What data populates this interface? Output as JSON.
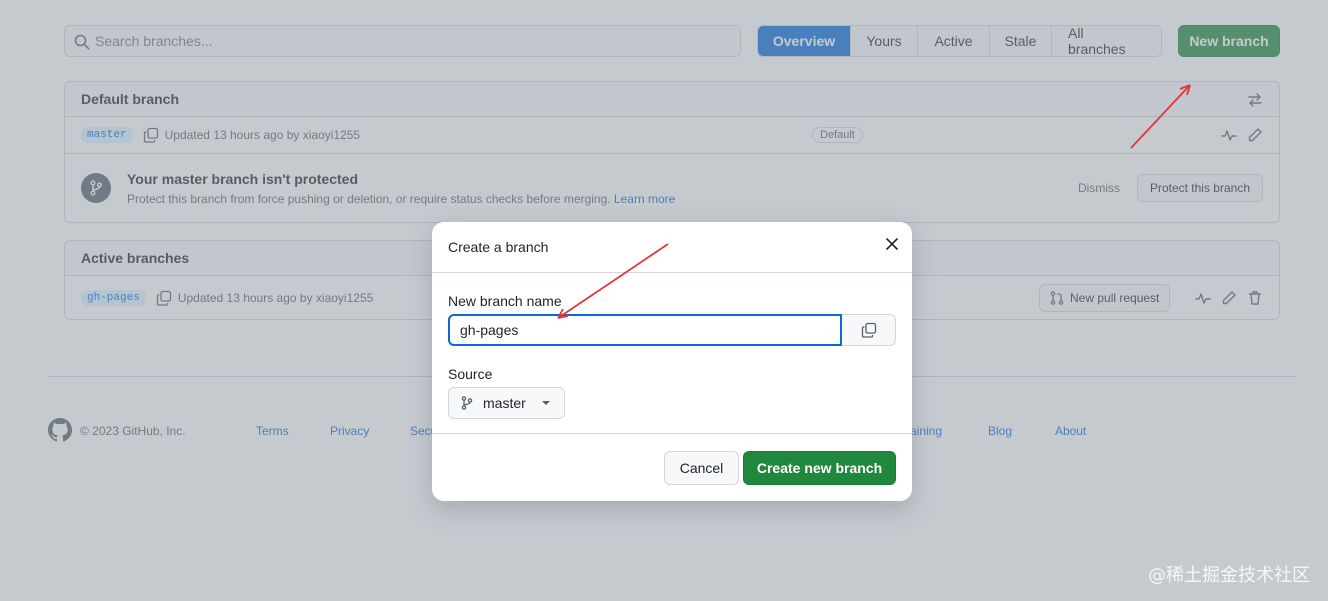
{
  "search": {
    "placeholder": "Search branches..."
  },
  "tabs": [
    {
      "label": "Overview",
      "active": true
    },
    {
      "label": "Yours",
      "active": false
    },
    {
      "label": "Active",
      "active": false
    },
    {
      "label": "Stale",
      "active": false
    },
    {
      "label": "All branches",
      "active": false
    }
  ],
  "new_branch_label": "New branch",
  "default_branch": {
    "header": "Default branch",
    "branch_name": "master",
    "updated": "Updated 13 hours ago by xiaoyi1255",
    "badge": "Default",
    "protect_title": "Your master branch isn't protected",
    "protect_desc": "Protect this branch from force pushing or deletion, or require status checks before merging.",
    "learn_more": "Learn more",
    "dismiss": "Dismiss",
    "protect_button": "Protect this branch"
  },
  "active_branches": {
    "header": "Active branches",
    "branch_name": "gh-pages",
    "updated": "Updated 13 hours ago by xiaoyi1255",
    "new_pr": "New pull request"
  },
  "footer": {
    "copyright": "© 2023 GitHub, Inc.",
    "links": [
      "Terms",
      "Privacy",
      "Secu",
      "aining",
      "Blog",
      "About"
    ]
  },
  "modal": {
    "title": "Create a branch",
    "name_label": "New branch name",
    "name_value": "gh-pages",
    "source_label": "Source",
    "source_value": "master",
    "cancel": "Cancel",
    "create": "Create new branch"
  },
  "watermark": "@稀土掘金技术社区",
  "colors": {
    "accent": "#0969da",
    "green": "#1f883d",
    "annotation": "#e5343a"
  }
}
